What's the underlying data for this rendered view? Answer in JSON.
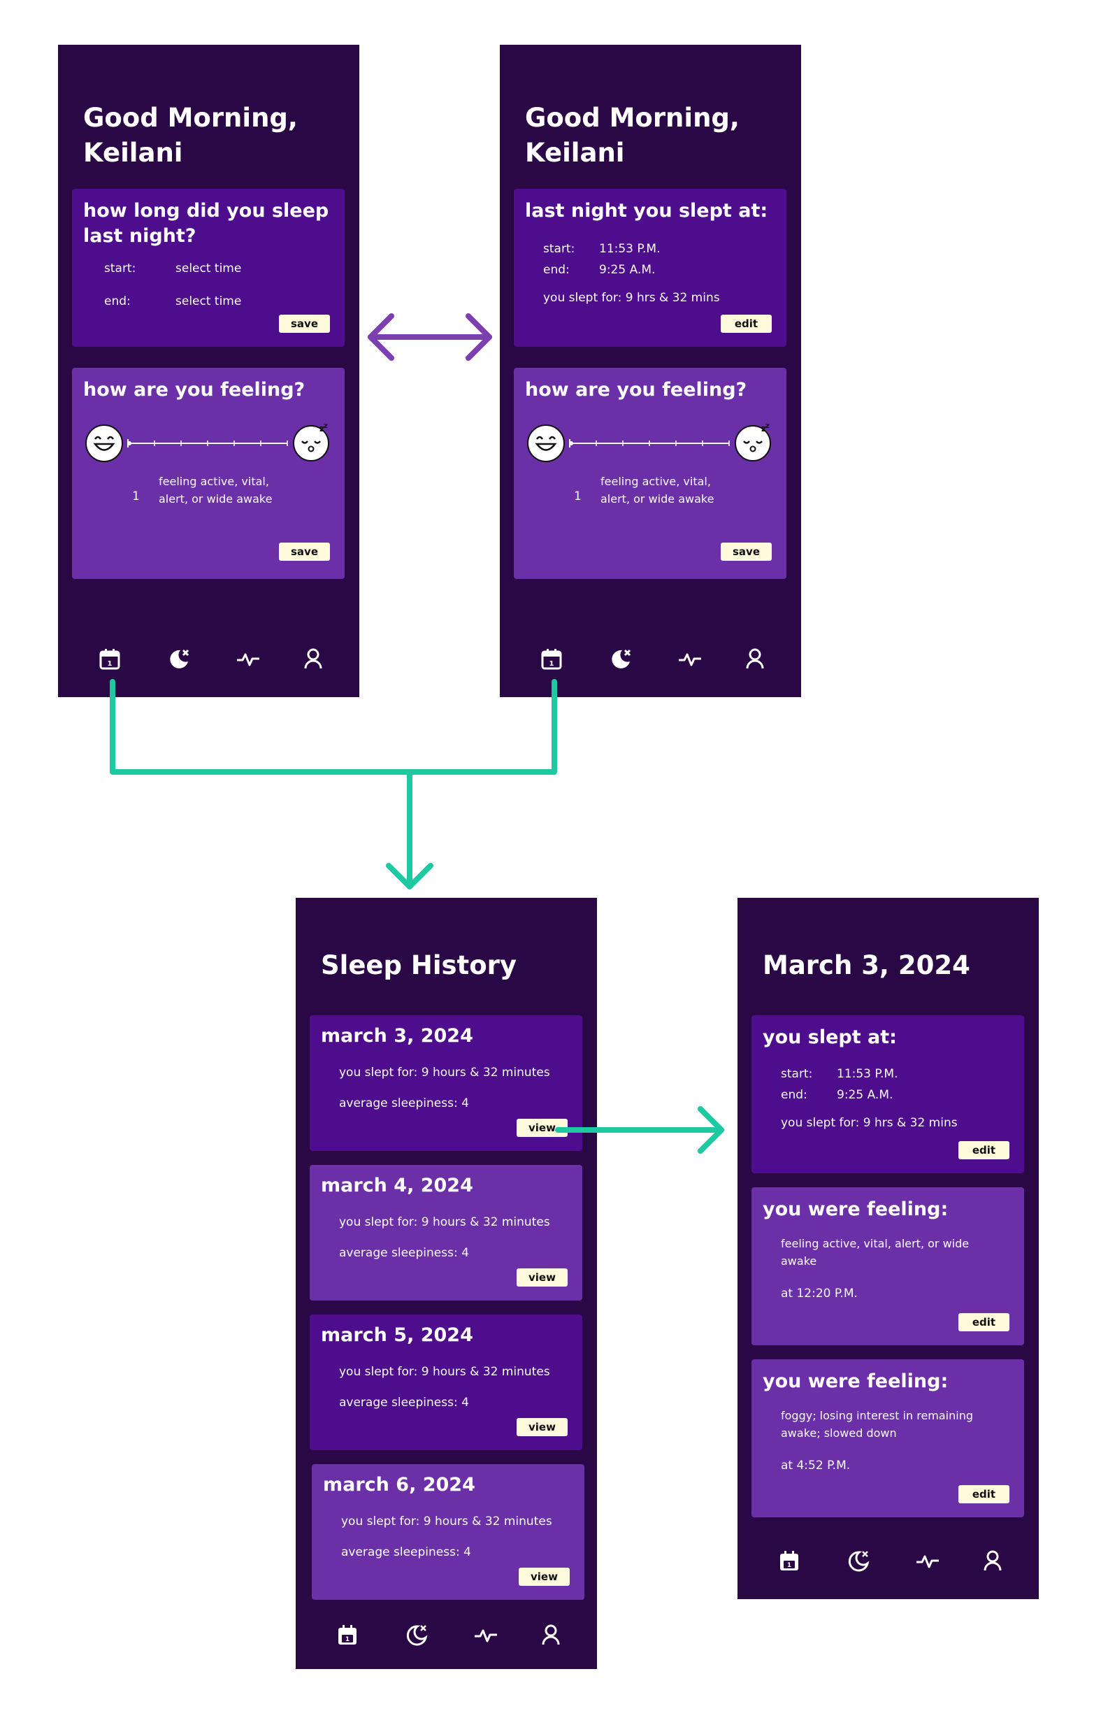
{
  "greeting": {
    "line1": "Good Morning,",
    "line2": "Keilani"
  },
  "colors": {
    "bg": "#2a0845",
    "card_dark": "#4d0d8c",
    "card_light": "#6b2fa8",
    "button": "#fffadb",
    "flow_arrow": "#1ec8a0",
    "swap_arrow": "#7b3fb0"
  },
  "screen1": {
    "sleep_card": {
      "title": "how long did you sleep last night?",
      "start_label": "start:",
      "start_value": "select time",
      "end_label": "end:",
      "end_value": "select time",
      "save": "save"
    },
    "feeling_card": {
      "title": "how are you feeling?",
      "level": "1",
      "description": "feeling active, vital, alert, or wide awake",
      "save": "save",
      "scale_value": 1
    }
  },
  "screen2": {
    "sleep_card": {
      "title": "last night you slept at:",
      "start_label": "start:",
      "start_value": "11:53 P.M.",
      "end_label": "end:",
      "end_value": "9:25 A.M.",
      "duration": "you slept for: 9 hrs & 32 mins",
      "edit": "edit"
    },
    "feeling_card": {
      "title": "how are you feeling?",
      "level": "1",
      "description": "feeling active, vital, alert, or wide awake",
      "save": "save",
      "scale_value": 1
    }
  },
  "history": {
    "title": "Sleep History",
    "entries": [
      {
        "date": "march 3, 2024",
        "slept": "you slept for: 9 hours & 32 minutes",
        "sleepiness": "average sleepiness: 4",
        "view": "view"
      },
      {
        "date": "march 4, 2024",
        "slept": "you slept for: 9 hours & 32 minutes",
        "sleepiness": "average sleepiness: 4",
        "view": "view"
      },
      {
        "date": "march 5, 2024",
        "slept": "you slept for: 9 hours & 32 minutes",
        "sleepiness": "average sleepiness: 4",
        "view": "view"
      },
      {
        "date": "march 6, 2024",
        "slept": "you slept for: 9 hours & 32 minutes",
        "sleepiness": "average sleepiness: 4",
        "view": "view"
      }
    ]
  },
  "detail": {
    "title": "March 3, 2024",
    "sleep_card": {
      "title": "you slept at:",
      "start_label": "start:",
      "start_value": "11:53 P.M.",
      "end_label": "end:",
      "end_value": "9:25 A.M.",
      "duration": "you slept for: 9 hrs & 32 mins",
      "edit": "edit"
    },
    "feelings": [
      {
        "title": "you were feeling:",
        "description": "feeling active, vital, alert, or wide awake",
        "time": "at 12:20 P.M.",
        "edit": "edit"
      },
      {
        "title": "you were feeling:",
        "description": "foggy; losing interest in remaining awake; slowed down",
        "time": "at 4:52 P.M.",
        "edit": "edit"
      }
    ]
  },
  "nav_icons": [
    "calendar-icon",
    "moon-sleep-icon",
    "activity-pulse-icon",
    "profile-icon"
  ]
}
